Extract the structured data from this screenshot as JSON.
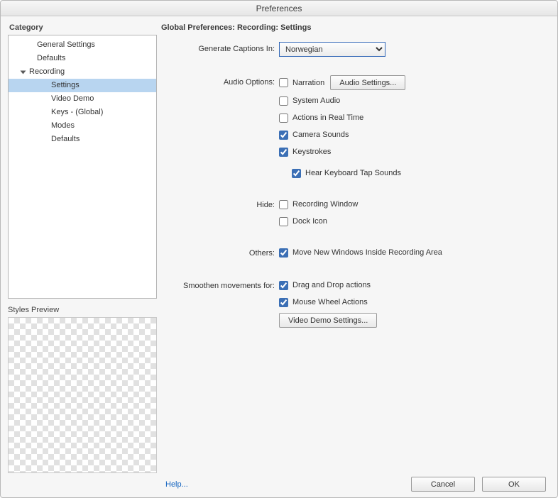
{
  "window": {
    "title": "Preferences"
  },
  "sidebar": {
    "label": "Category",
    "items": [
      {
        "label": "General Settings",
        "level": 1
      },
      {
        "label": "Defaults",
        "level": 1
      },
      {
        "label": "Recording",
        "level": 1,
        "expanded": true
      },
      {
        "label": "Settings",
        "level": 2,
        "selected": true
      },
      {
        "label": "Video Demo",
        "level": 2
      },
      {
        "label": "Keys - (Global)",
        "level": 2
      },
      {
        "label": "Modes",
        "level": 2
      },
      {
        "label": "Defaults",
        "level": 2
      }
    ]
  },
  "preview": {
    "label": "Styles Preview"
  },
  "main": {
    "title": "Global Preferences: Recording: Settings",
    "captions": {
      "label": "Generate Captions In:",
      "value": "Norwegian"
    },
    "audio": {
      "label": "Audio Options:",
      "narration": {
        "label": "Narration",
        "checked": false
      },
      "settings_btn": "Audio Settings...",
      "system_audio": {
        "label": "System Audio",
        "checked": false
      },
      "actions_rt": {
        "label": "Actions in Real Time",
        "checked": false
      },
      "camera_sounds": {
        "label": "Camera Sounds",
        "checked": true
      },
      "keystrokes": {
        "label": "Keystrokes",
        "checked": true
      },
      "hear_tap": {
        "label": "Hear Keyboard Tap Sounds",
        "checked": true
      }
    },
    "hide": {
      "label": "Hide:",
      "recording_window": {
        "label": "Recording Window",
        "checked": false
      },
      "dock_icon": {
        "label": "Dock Icon",
        "checked": false
      }
    },
    "others": {
      "label": "Others:",
      "move_windows": {
        "label": "Move New Windows Inside Recording Area",
        "checked": true
      }
    },
    "smooth": {
      "label": "Smoothen movements for:",
      "drag": {
        "label": "Drag and Drop actions",
        "checked": true
      },
      "wheel": {
        "label": "Mouse Wheel Actions",
        "checked": true
      },
      "video_demo_btn": "Video Demo Settings..."
    }
  },
  "footer": {
    "help": "Help...",
    "cancel": "Cancel",
    "ok": "OK"
  }
}
